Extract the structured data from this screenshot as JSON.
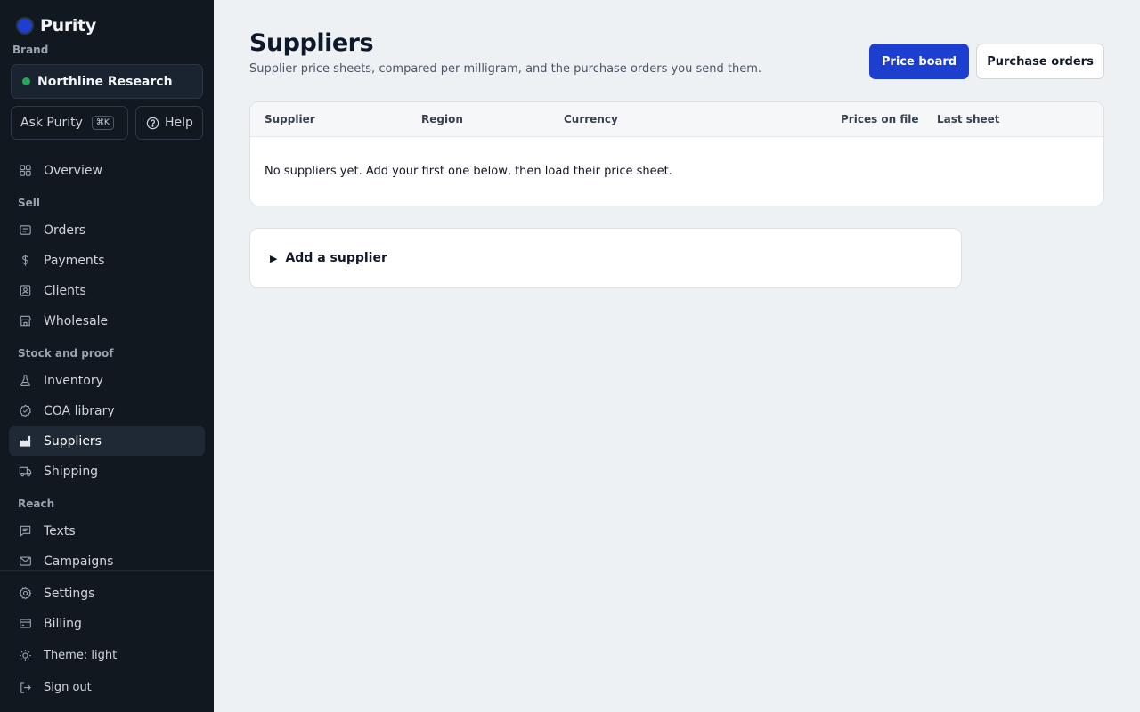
{
  "app": {
    "name": "Purity"
  },
  "sidebar": {
    "brand_label": "Brand",
    "brand_name": "Northline Research",
    "ask_label": "Ask Purity",
    "ask_shortcut": "⌘K",
    "help_label": "Help",
    "overview": "Overview",
    "sections": {
      "sell": "Sell",
      "stock": "Stock and proof",
      "reach": "Reach"
    },
    "items": {
      "orders": "Orders",
      "payments": "Payments",
      "clients": "Clients",
      "wholesale": "Wholesale",
      "inventory": "Inventory",
      "coa": "COA library",
      "suppliers": "Suppliers",
      "shipping": "Shipping",
      "texts": "Texts",
      "campaigns": "Campaigns"
    },
    "bottom": {
      "settings": "Settings",
      "billing": "Billing",
      "theme": "Theme: light",
      "signout": "Sign out"
    }
  },
  "main": {
    "title": "Suppliers",
    "subtitle": "Supplier price sheets, compared per milligram, and the purchase orders you send them.",
    "actions": {
      "price_board": "Price board",
      "purchase_orders": "Purchase orders"
    },
    "table": {
      "columns": [
        "Supplier",
        "Region",
        "Currency",
        "Prices on file",
        "Last sheet"
      ],
      "empty_message": "No suppliers yet. Add your first one below, then load their price sheet."
    },
    "add_supplier": "Add a supplier"
  },
  "colors": {
    "accent": "#1d3fcf",
    "sidebar_bg": "#111820",
    "page_bg": "#eef1f4",
    "status_green": "#1faa59"
  }
}
